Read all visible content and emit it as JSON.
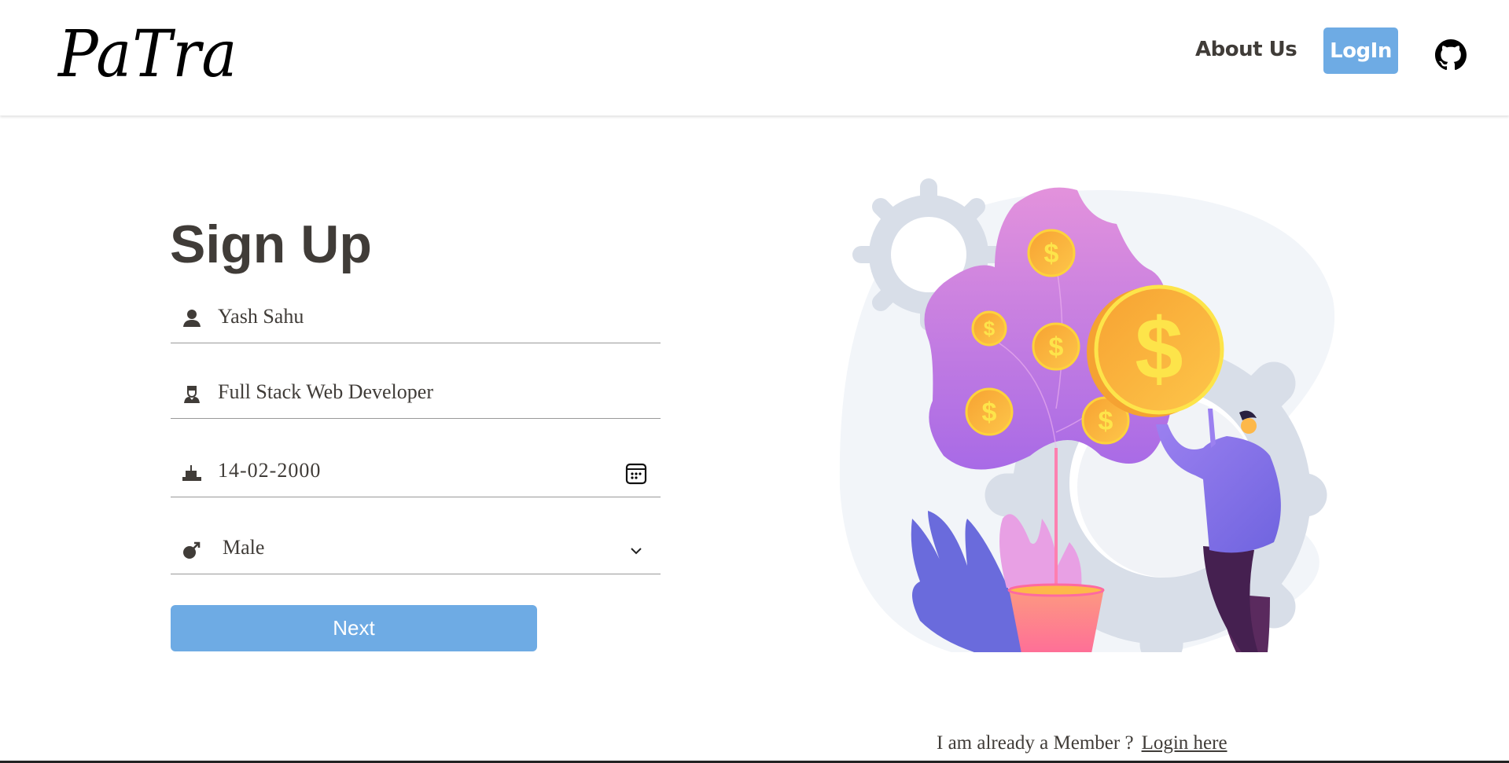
{
  "header": {
    "logo": "PaTra",
    "nav": {
      "about": "About Us",
      "login": "LogIn"
    },
    "github_icon": "github-icon"
  },
  "form": {
    "title": "Sign Up",
    "fields": [
      {
        "icon": "user-icon",
        "value": "Yash Sahu"
      },
      {
        "icon": "worker-icon",
        "value": "Full Stack Web Developer"
      },
      {
        "icon": "birthday-cake-icon",
        "value": "14-02-2000",
        "trailing_icon": "calendar-icon"
      },
      {
        "icon": "male-icon",
        "value": "Male",
        "trailing_icon": "chevron-down-icon"
      }
    ],
    "next_label": "Next"
  },
  "footer": {
    "member_text": "I am already a Member ?",
    "login_link": "Login here"
  },
  "colors": {
    "accent": "#6eabe4",
    "text": "#403c38"
  }
}
